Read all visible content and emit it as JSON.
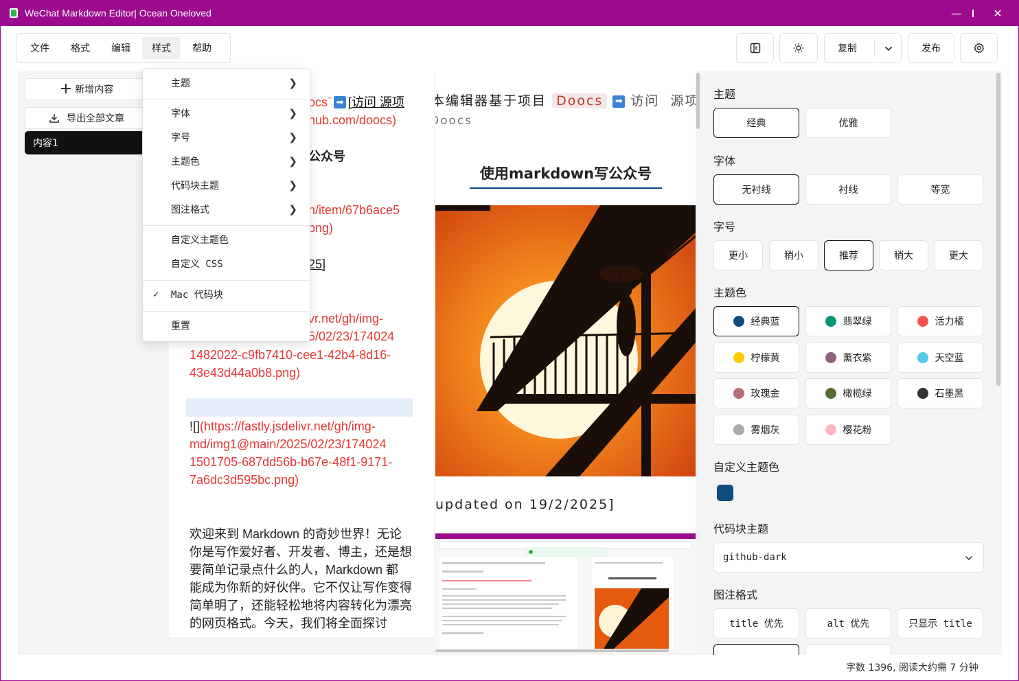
{
  "window": {
    "title": "WeChat Markdown Editor| Ocean Oneloved"
  },
  "menubar": [
    "文件",
    "格式",
    "编辑",
    "样式",
    "帮助"
  ],
  "toolbar": {
    "copy_label": "复制",
    "publish_label": "发布"
  },
  "sidebar": {
    "add_label": "新增内容",
    "export_label": "导出全部文章",
    "items": [
      "内容1"
    ]
  },
  "editor": {
    "lines": [
      "ocs`",
      "[访问 源项",
      "hub.com/doocs)",
      "公众号",
      "n/item/67b6ace5",
      "png)",
      "25]",
      "vr.net/gh/img-",
      "5/02/23/174024",
      "1482022-c9fb7410-cee1-42b4-8d16-",
      "43e43d44a0b8.png)",
      "![]",
      "(https://fastly.jsdelivr.net/gh/img-",
      "md/img1@main/2025/02/23/174024",
      "1501705-687dd56b-b67e-48f1-9171-",
      "7a6dc3d595bc.png)",
      "欢迎来到 Markdown 的奇妙世界！无论",
      "你是写作爱好者、开发者、博主，还是想",
      "要简单记录点什么的人，Markdown 都",
      "能成为你新的好伙伴。它不仅让写作变得",
      "简单明了，还能轻松地将内容转化为漂亮",
      "的网页格式。今天，我们将全面探讨"
    ]
  },
  "preview": {
    "intro": "本编辑器基于项目",
    "doocs_tag": "Doocs",
    "visit": "访问",
    "source": "源项目",
    "doocs_line": "Doocs",
    "heading": "使用markdown写公众号",
    "updated": "updated on 19/2/2025]"
  },
  "style_menu": {
    "items": [
      "主题",
      "字体",
      "字号",
      "主题色",
      "代码块主题",
      "图注格式",
      "自定义主题色",
      "自定义 CSS",
      "Mac 代码块",
      "重置"
    ]
  },
  "panel": {
    "theme_title": "主题",
    "themes": [
      "经典",
      "优雅"
    ],
    "font_title": "字体",
    "fonts": [
      "无衬线",
      "衬线",
      "等宽"
    ],
    "size_title": "字号",
    "sizes": [
      "更小",
      "稍小",
      "推荐",
      "稍大",
      "更大"
    ],
    "color_title": "主题色",
    "colors": [
      {
        "name": "经典蓝",
        "hex": "#0f4c81"
      },
      {
        "name": "翡翠绿",
        "hex": "#009874"
      },
      {
        "name": "活力橘",
        "hex": "#fa5151"
      },
      {
        "name": "柠檬黄",
        "hex": "#fecc00"
      },
      {
        "name": "薰衣紫",
        "hex": "#92617e"
      },
      {
        "name": "天空蓝",
        "hex": "#55c9ea"
      },
      {
        "name": "玫瑰金",
        "hex": "#b76e79"
      },
      {
        "name": "橄榄绿",
        "hex": "#556b2f"
      },
      {
        "name": "石墨黑",
        "hex": "#333333"
      },
      {
        "name": "雾烟灰",
        "hex": "#a9a9a9"
      },
      {
        "name": "樱花粉",
        "hex": "#ffb7c5"
      }
    ],
    "custom_color_title": "自定义主题色",
    "custom_color_hex": "#0f4c81",
    "code_theme_title": "代码块主题",
    "code_theme_value": "github-dark",
    "caption_title": "图注格式",
    "captions": [
      "title 优先",
      "alt 优先",
      "只显示 title"
    ]
  },
  "status": {
    "text": "字数 1396, 阅读大约需 7 分钟"
  }
}
